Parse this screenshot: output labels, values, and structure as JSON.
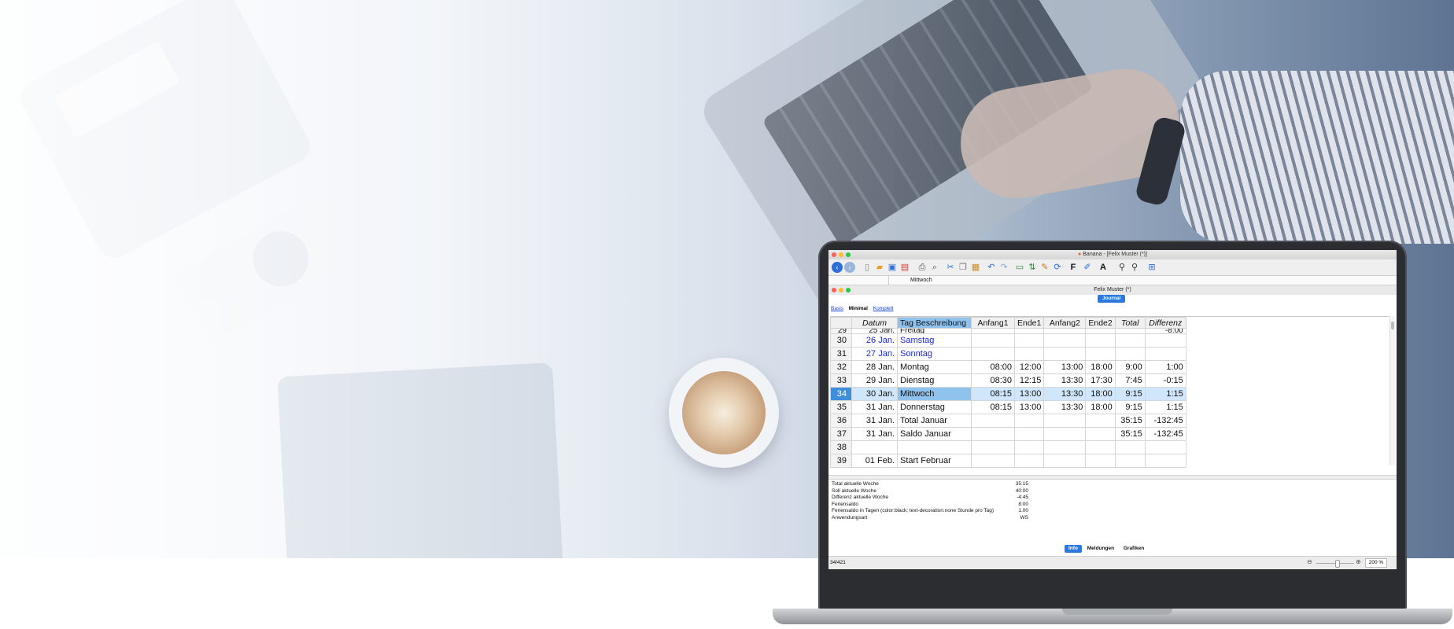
{
  "window": {
    "app_title": "Banana - [Felix Muster (*)]",
    "doc_title": "Felix Muster (*)",
    "cell_value": "Mittwoch"
  },
  "tabs": {
    "journal": "Journal",
    "views": [
      "Basis",
      "Minimal",
      "Komplett"
    ],
    "bottom": [
      "Info",
      "Meldungen",
      "Grafiken"
    ]
  },
  "table": {
    "headers": [
      "Datum",
      "Tag Beschreibung",
      "Anfang1",
      "Ende1",
      "Anfang2",
      "Ende2",
      "Total",
      "Differenz"
    ],
    "partial_row": {
      "n": "29",
      "date": "25 Jan.",
      "desc": "Freitag",
      "diff": "-8:00"
    },
    "rows": [
      {
        "n": "30",
        "date": "26 Jan.",
        "desc": "Samstag",
        "a1": "",
        "e1": "",
        "a2": "",
        "e2": "",
        "total": "",
        "diff": ""
      },
      {
        "n": "31",
        "date": "27 Jan.",
        "desc": "Sonntag",
        "a1": "",
        "e1": "",
        "a2": "",
        "e2": "",
        "total": "",
        "diff": ""
      },
      {
        "n": "32",
        "date": "28 Jan.",
        "desc": "Montag",
        "a1": "08:00",
        "e1": "12:00",
        "a2": "13:00",
        "e2": "18:00",
        "total": "9:00",
        "diff": "1:00"
      },
      {
        "n": "33",
        "date": "29 Jan.",
        "desc": "Dienstag",
        "a1": "08:30",
        "e1": "12:15",
        "a2": "13:30",
        "e2": "17:30",
        "total": "7:45",
        "diff": "-0:15"
      },
      {
        "n": "34",
        "date": "30 Jan.",
        "desc": "Mittwoch",
        "a1": "08:15",
        "e1": "13:00",
        "a2": "13:30",
        "e2": "18:00",
        "total": "9:15",
        "diff": "1:15"
      },
      {
        "n": "35",
        "date": "31 Jan.",
        "desc": "Donnerstag",
        "a1": "08:15",
        "e1": "13:00",
        "a2": "13:30",
        "e2": "18:00",
        "total": "9:15",
        "diff": "1:15"
      },
      {
        "n": "36",
        "date": "31 Jan.",
        "desc": "Total Januar",
        "a1": "",
        "e1": "",
        "a2": "",
        "e2": "",
        "total": "35:15",
        "diff": "-132:45"
      },
      {
        "n": "37",
        "date": "31 Jan.",
        "desc": "Saldo Januar",
        "a1": "",
        "e1": "",
        "a2": "",
        "e2": "",
        "total": "35:15",
        "diff": "-132:45"
      },
      {
        "n": "38",
        "date": "",
        "desc": "",
        "a1": "",
        "e1": "",
        "a2": "",
        "e2": "",
        "total": "",
        "diff": ""
      },
      {
        "n": "39",
        "date": "01 Feb.",
        "desc": "Start Februar",
        "a1": "",
        "e1": "",
        "a2": "",
        "e2": "",
        "total": "",
        "diff": ""
      }
    ],
    "selected_row": "34",
    "weekend_rows": [
      "30",
      "31"
    ]
  },
  "info": [
    {
      "label": "Total aktuelle Woche",
      "value": "35:15"
    },
    {
      "label": "Soll aktuelle Woche",
      "value": "40:00"
    },
    {
      "label": "Differenz aktuelle Woche",
      "value": "-4:45"
    },
    {
      "label": "Feriensaldo",
      "value": "8:00"
    },
    {
      "label": "Feriensaldo in Tagen (color:black; text-decoration:none Stunde pro Tag)",
      "value": "1.00"
    },
    {
      "label": "Anwendungsart",
      "value": "WS"
    }
  ],
  "status": {
    "position": "34/421",
    "zoom": "200 %"
  },
  "colors": {
    "selection": "#3f8edb",
    "focus_cell": "#8fc3ee",
    "weekend_text": "#1c2ad6",
    "tab_active": "#2b79e0"
  }
}
